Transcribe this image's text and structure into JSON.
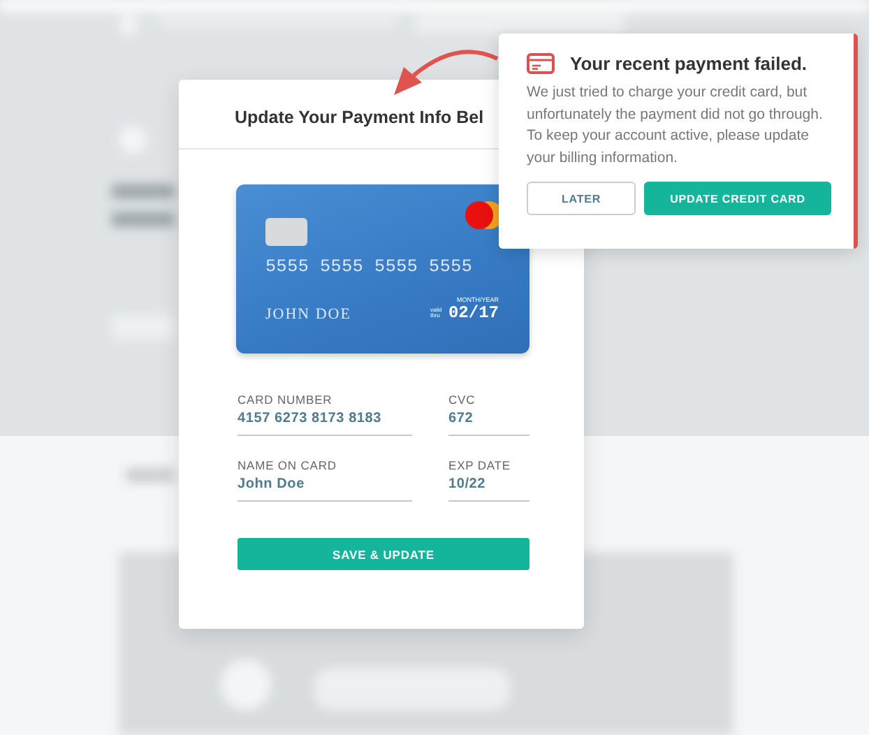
{
  "modal": {
    "title": "Update Your Payment Info Bel",
    "card": {
      "number": "5555 5555 5555 5555",
      "holder": "JOHN DOE",
      "expiry_caption": "MONTH/YEAR",
      "valid_caption": "valid thru",
      "expiry": "02/17"
    },
    "fields": [
      {
        "label": "CARD NUMBER",
        "value": "4157 6273 8173 8183"
      },
      {
        "label": "CVC",
        "value": "672"
      },
      {
        "label": "NAME ON CARD",
        "value": "John Doe"
      },
      {
        "label": "EXP DATE",
        "value": "10/22"
      }
    ],
    "submit": "SAVE & UPDATE"
  },
  "notice": {
    "title": "Your recent payment failed.",
    "message": "We just tried to charge your credit card, but unfortunately the payment did not go through. To keep your account active, please update your billing information.",
    "buttons": [
      {
        "label": "LATER",
        "kind": "secondary"
      },
      {
        "label": "UPDATE CREDIT CARD",
        "kind": "primary"
      }
    ]
  }
}
